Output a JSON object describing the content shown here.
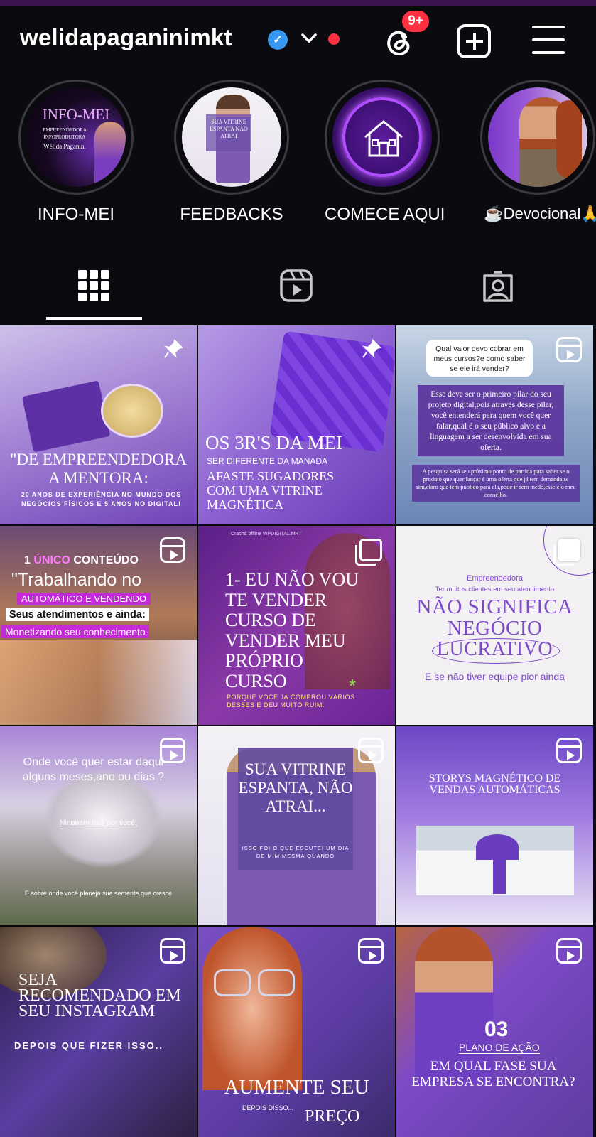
{
  "profile": {
    "username": "welidapaganinimkt",
    "verified_glyph": "✓",
    "notification_badge": "9+"
  },
  "highlights": [
    {
      "label": "INFO-MEI",
      "cover_title": "INFO-MEI",
      "cover_line1": "EMPREENDEDORA",
      "cover_line2": "INFOPRODUTORA",
      "cover_name": "Wélida Paganini"
    },
    {
      "label": "FEEDBACKS",
      "cover_text": "SUA VITRINE ESPANTA NÃO ATRAI"
    },
    {
      "label": "COMECE AQUI"
    },
    {
      "label": "☕Devocional🙏"
    }
  ],
  "tabs": [
    {
      "name": "posts-grid",
      "active": true
    },
    {
      "name": "reels"
    },
    {
      "name": "tagged"
    }
  ],
  "posts": [
    {
      "title": "\"DE EMPREENDEDORA A MENTORA:",
      "body": "20 ANOS DE EXPERIÊNCIA NO MUNDO DOS NEGÓCIOS FÍSICOS E 5 ANOS NO DIGITAL!",
      "badge": "pin"
    },
    {
      "title": "OS 3R'S DA MEI",
      "subtitle": "SER DIFERENTE DA MANADA",
      "body": "AFASTE SUGADORES COM UMA VITRINE MAGNÉTICA",
      "badge": "pin"
    },
    {
      "question": "Qual valor devo cobrar em meus cursos?e como saber se ele irá vender?",
      "body": "Esse deve ser o primeiro pilar do seu projeto digital,pois através desse pilar, você entenderá para quem você quer falar,qual é o seu público alvo e a linguagem a ser desenvolvida em sua oferta.",
      "footer": "A pesquisa será seu próximo ponto de partida para saber se o produto que quer lançar é uma oferta que já tem demanda,se sim,claro que tem público para ela,pode ir sem medo,esse é o meu conselho.",
      "badge": "reel"
    },
    {
      "line1_a": "1",
      "line1_b": "ÚNICO",
      "line1_c": "CONTEÚDO",
      "line2": "\"Trabalhando no",
      "line3": "AUTOMÁTICO E VENDENDO",
      "line4": "Seus atendimentos e ainda:",
      "line5": "Monetizando seu conhecimento",
      "badge": "reel"
    },
    {
      "top": "Crachá offline WPDIGITAL.MKT",
      "title": "1- EU NÃO VOU TE VENDER CURSO DE VENDER MEU PRÓPRIO CURSO",
      "body": "PORQUE VOCÊ JÁ COMPROU VÁRIOS DESSES E DEU MUITO RUIM.",
      "star": "*",
      "badge": "multi"
    },
    {
      "line1": "Empreendedora",
      "line2": "Ter muitos clientes em seu atendimento",
      "line3": "NÃO SIGNIFICA",
      "line4": "NEGÓCIO",
      "line5": "LUCRATIVO",
      "line6": "E se não tiver equipe pior ainda",
      "badge": "multi"
    },
    {
      "title": "Onde você quer estar daqui alguns meses,ano ou dias ?",
      "link": "Ninguém fará por você!",
      "footer": "E sobre onde você planeja sua semente que cresce",
      "badge": "reel"
    },
    {
      "title": "SUA VITRINE ESPANTA, NÃO ATRAI...",
      "body": "ISSO FOI O QUE ESCUTEI UM DIA DE MIM MESMA QUANDO",
      "badge": "reel"
    },
    {
      "title": "STORYS MAGNÉTICO DE VENDAS AUTOMÁTICAS",
      "badge": "reel"
    },
    {
      "title": "SEJA RECOMENDADO EM SEU INSTAGRAM",
      "body": "DEPOIS QUE FIZER ISSO..",
      "badge": "reel"
    },
    {
      "title": "AUMENTE SEU",
      "sub": "DEPOIS DISSO...",
      "tail": "PREÇO",
      "badge": "reel"
    },
    {
      "num": "03",
      "label": "PLANO DE AÇÃO",
      "title": "EM QUAL FASE SUA EMPRESA SE ENCONTRA?",
      "badge": "reel"
    }
  ],
  "colors": {
    "background": "#0b0b0f",
    "accent_purple": "#7b3fd1",
    "badge_red": "#ff3040",
    "verified_blue": "#3897f0"
  }
}
